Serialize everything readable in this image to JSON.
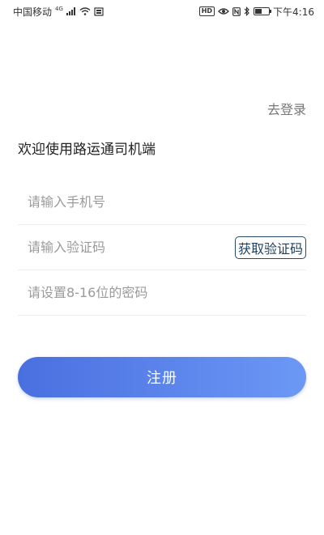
{
  "status_bar": {
    "carrier": "中国移动",
    "network": "4G",
    "time": "下午4:16",
    "hd": "HD",
    "battery_level": 0.5,
    "icons": [
      "signal-icon",
      "wifi-icon",
      "sim-icon",
      "hd-icon",
      "eye-icon",
      "nfc-icon",
      "bluetooth-icon",
      "battery-icon"
    ]
  },
  "header": {
    "login_link": "去登录"
  },
  "welcome_text": "欢迎使用路运通司机端",
  "form": {
    "phone_placeholder": "请输入手机号",
    "code_placeholder": "请输入验证码",
    "get_code_label": "获取验证码",
    "password_placeholder": "请设置8-16位的密码"
  },
  "register_label": "注册",
  "colors": {
    "accent_start": "#4a6fe0",
    "accent_end": "#6c98f5",
    "code_btn_border": "#2a4a6a"
  }
}
